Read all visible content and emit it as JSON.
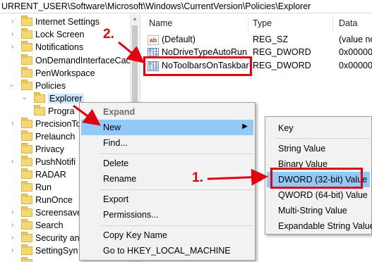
{
  "address_bar": {
    "path": "URRENT_USER\\Software\\Microsoft\\Windows\\CurrentVersion\\Policies\\Explorer"
  },
  "tree": {
    "items": [
      {
        "label": "Internet Settings"
      },
      {
        "label": "Lock Screen"
      },
      {
        "label": "Notifications"
      },
      {
        "label": "OnDemandInterfaceCac"
      },
      {
        "label": "PenWorkspace"
      },
      {
        "label": "Policies"
      },
      {
        "label": "Explorer"
      },
      {
        "label": "Progra"
      },
      {
        "label": "PrecisionTo"
      },
      {
        "label": "Prelaunch"
      },
      {
        "label": "Privacy"
      },
      {
        "label": "PushNotifi"
      },
      {
        "label": "RADAR"
      },
      {
        "label": "Run"
      },
      {
        "label": "RunOnce"
      },
      {
        "label": "Screensave"
      },
      {
        "label": "Search"
      },
      {
        "label": "Security an"
      },
      {
        "label": "SettingSyn"
      }
    ]
  },
  "values_list": {
    "columns": {
      "name": "Name",
      "type": "Type",
      "data": "Data"
    },
    "rows": [
      {
        "name": "(Default)",
        "type": "REG_SZ",
        "data": "(value no",
        "icon": "string-value-icon"
      },
      {
        "name": "NoDriveTypeAutoRun",
        "type": "REG_DWORD",
        "data": "0x000000",
        "icon": "binary-value-icon"
      },
      {
        "name": "NoToolbarsOnTaskbar",
        "type": "REG_DWORD",
        "data": "0x000000",
        "icon": "binary-value-icon"
      }
    ]
  },
  "context_menu": {
    "expand": "Expand",
    "new": "New",
    "find": "Find...",
    "delete": "Delete",
    "rename": "Rename",
    "export": "Export",
    "permissions": "Permissions...",
    "copy_key_name": "Copy Key Name",
    "goto": "Go to HKEY_LOCAL_MACHINE"
  },
  "submenu": {
    "key": "Key",
    "string_value": "String Value",
    "binary_value": "Binary Value",
    "dword_value": "DWORD (32-bit) Value",
    "qword_value": "QWORD (64-bit) Value",
    "multi_string_value": "Multi-String Value",
    "expandable_string_value": "Expandable String Value"
  },
  "annotations": {
    "step1": "1.",
    "step2": "2."
  },
  "colors": {
    "annotation_red": "#e3000f",
    "menu_highlight": "#91c9f7",
    "selection": "#cce8ff"
  }
}
